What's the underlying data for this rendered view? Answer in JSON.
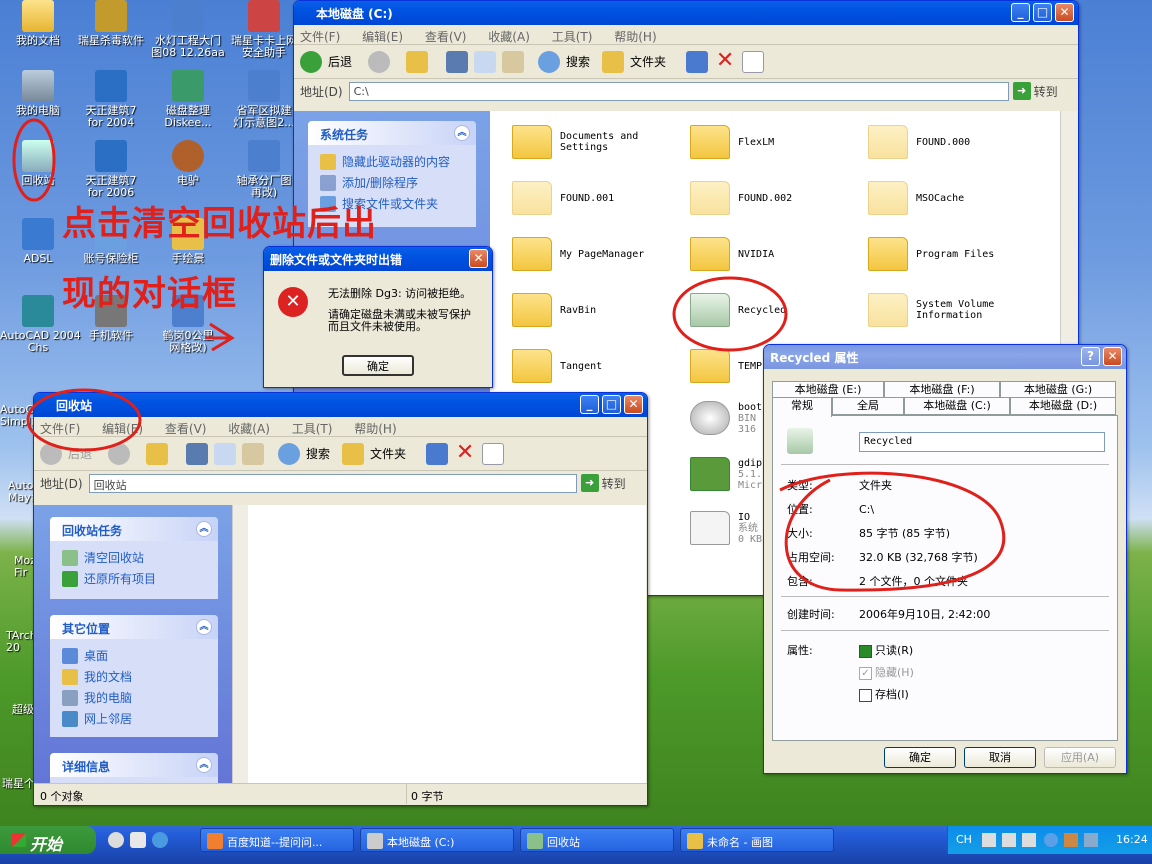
{
  "desktop": {
    "icons": [
      {
        "label": "我的文档"
      },
      {
        "label": "瑞星杀毒软件"
      },
      {
        "label": "水灯工程大门\n图08 12.26aa"
      },
      {
        "label": "瑞星卡卡上网\n安全助手"
      },
      {
        "label": "我的电脑"
      },
      {
        "label": "天正建筑7\nfor 2004"
      },
      {
        "label": "磁盘整理\nDiskee..."
      },
      {
        "label": "省军区拟建\n灯示意图2..."
      },
      {
        "label": "回收站"
      },
      {
        "label": "天正建筑7\nfor 2006"
      },
      {
        "label": "电驴"
      },
      {
        "label": "轴承分厂图\n再改)"
      },
      {
        "label": "ADSL"
      },
      {
        "label": "账号保险柜"
      },
      {
        "label": "手绘景"
      },
      {
        "label": "AutoCAD 2004\nChs"
      },
      {
        "label": "手机软件"
      },
      {
        "label": "鹤岗0公里\n网格改)"
      }
    ],
    "edge_labels": [
      "AutoCA\nSimpli",
      "Auto\nMaya",
      "Moz\nFir",
      "TArch\n20",
      "超级",
      "瑞星个"
    ]
  },
  "annotation": {
    "line1": "点击清空回收站后出",
    "line2": "现的对话框"
  },
  "explorer_c": {
    "title": "本地磁盘 (C:)",
    "menu": [
      "文件(F)",
      "编辑(E)",
      "查看(V)",
      "收藏(A)",
      "工具(T)",
      "帮助(H)"
    ],
    "toolbar": {
      "back": "后退",
      "search": "搜索",
      "folders": "文件夹"
    },
    "address_label": "地址(D)",
    "address_value": "C:\\",
    "go": "转到",
    "tasks_title": "系统任务",
    "tasks": [
      "隐藏此驱动器的内容",
      "添加/删除程序",
      "搜索文件或文件夹"
    ],
    "items": [
      "Documents and\nSettings",
      "FlexLM",
      "FOUND.000",
      "FOUND.001",
      "FOUND.002",
      "MSOCache",
      "My PageManager",
      "NVIDIA",
      "Program Files",
      "RavBin",
      "Recycled",
      "System Volume\nInformation",
      "Tangent",
      "TEMP"
    ],
    "files": [
      {
        "name": "boot",
        "sub1": "BIN",
        "sub2": "316"
      },
      {
        "name": "gdip",
        "sub1": "5.1.",
        "sub2": "Micr"
      },
      {
        "name": "IO",
        "sub1": "系统",
        "sub2": "0 KB"
      }
    ]
  },
  "error_dialog": {
    "title": "删除文件或文件夹时出错",
    "message1": "无法删除 Dg3: 访问被拒绝。",
    "message2": "请确定磁盘未满或未被写保护\n而且文件未被使用。",
    "ok": "确定"
  },
  "recycle_bin": {
    "title": "回收站",
    "menu": [
      "文件(F)",
      "编辑(E)",
      "查看(V)",
      "收藏(A)",
      "工具(T)",
      "帮助(H)"
    ],
    "toolbar": {
      "back": "后退",
      "search": "搜索",
      "folders": "文件夹"
    },
    "address_label": "地址(D)",
    "address_value": "回收站",
    "go": "转到",
    "tasks_title": "回收站任务",
    "tasks": [
      "清空回收站",
      "还原所有项目"
    ],
    "places_title": "其它位置",
    "places": [
      "桌面",
      "我的文档",
      "我的电脑",
      "网上邻居"
    ],
    "details_title": "详细信息",
    "status_left": "0 个对象",
    "status_right": "0 字节"
  },
  "properties": {
    "title": "Recycled 属性",
    "tabs_back": [
      "本地磁盘 (E:)",
      "本地磁盘 (F:)",
      "本地磁盘 (G:)"
    ],
    "tabs_front": [
      "常规",
      "全局",
      "本地磁盘 (C:)",
      "本地磁盘 (D:)"
    ],
    "name": "Recycled",
    "rows": [
      {
        "k": "类型:",
        "v": "文件夹"
      },
      {
        "k": "位置:",
        "v": "C:\\"
      },
      {
        "k": "大小:",
        "v": "85 字节 (85 字节)"
      },
      {
        "k": "占用空间:",
        "v": "32.0 KB (32,768 字节)"
      },
      {
        "k": "包含:",
        "v": "2 个文件，0 个文件夹"
      }
    ],
    "created_k": "创建时间:",
    "created_v": "2006年9月10日, 2:42:00",
    "attr_k": "属性:",
    "attrs": [
      "只读(R)",
      "隐藏(H)",
      "存档(I)"
    ],
    "buttons": [
      "确定",
      "取消",
      "应用(A)"
    ]
  },
  "taskbar": {
    "start": "开始",
    "items": [
      "百度知道--提问问...",
      "本地磁盘 (C:)",
      "回收站",
      "未命名 - 画图"
    ],
    "tray_ime": "CH",
    "clock": "16:24"
  }
}
